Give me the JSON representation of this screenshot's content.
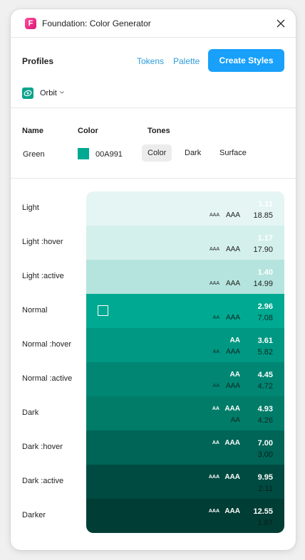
{
  "app": {
    "title": "Foundation: Color Generator",
    "logo_letter": "F"
  },
  "profiles": {
    "label": "Profiles",
    "tokens_label": "Tokens",
    "palette_label": "Palette",
    "create_label": "Create Styles",
    "current_profile": "Orbit"
  },
  "color_table": {
    "headers": {
      "name": "Name",
      "color": "Color",
      "tones": "Tones"
    },
    "row": {
      "name": "Green",
      "hex": "00A991",
      "swatch_color": "#00A991"
    },
    "tabs": [
      "Color",
      "Dark",
      "Surface"
    ],
    "active_tab": "Color"
  },
  "tones": [
    {
      "label": "Light",
      "bg": "#E4F5F3",
      "ratio_top": "1.11",
      "ratio_bottom": "18.85",
      "small_top": "",
      "badge_top": "",
      "small_bottom": "AAA",
      "badge_bottom": "AAA"
    },
    {
      "label": "Light :hover",
      "bg": "#D4F0EC",
      "ratio_top": "1.17",
      "ratio_bottom": "17.90",
      "small_top": "",
      "badge_top": "",
      "small_bottom": "AAA",
      "badge_bottom": "AAA"
    },
    {
      "label": "Light :active",
      "bg": "#B4E4DD",
      "ratio_top": "1.40",
      "ratio_bottom": "14.99",
      "small_top": "",
      "badge_top": "",
      "small_bottom": "AAA",
      "badge_bottom": "AAA"
    },
    {
      "label": "Normal",
      "bg": "#00A991",
      "ratio_top": "2.96",
      "ratio_bottom": "7.08",
      "small_top": "",
      "badge_top": "",
      "small_bottom": "AA",
      "badge_bottom": "AAA"
    },
    {
      "label": "Normal :hover",
      "bg": "#009882",
      "ratio_top": "3.61",
      "ratio_bottom": "5.82",
      "small_top": "",
      "badge_top": "AA",
      "small_bottom": "AA",
      "badge_bottom": "AAA"
    },
    {
      "label": "Normal :active",
      "bg": "#008673",
      "ratio_top": "4.45",
      "ratio_bottom": "4.72",
      "small_top": "",
      "badge_top": "AA",
      "small_bottom": "AA",
      "badge_bottom": "AAA"
    },
    {
      "label": "Dark",
      "bg": "#007C69",
      "ratio_top": "4.93",
      "ratio_bottom": "4.26",
      "small_top": "AA",
      "badge_top": "AAA",
      "small_bottom": "",
      "badge_bottom": "AA"
    },
    {
      "label": "Dark :hover",
      "bg": "#006456",
      "ratio_top": "7.00",
      "ratio_bottom": "3.00",
      "small_top": "AA",
      "badge_top": "AAA",
      "small_bottom": "",
      "badge_bottom": ""
    },
    {
      "label": "Dark :active",
      "bg": "#004B41",
      "ratio_top": "9.95",
      "ratio_bottom": "2.11",
      "small_top": "AAA",
      "badge_top": "AAA",
      "small_bottom": "",
      "badge_bottom": ""
    },
    {
      "label": "Darker",
      "bg": "#003D34",
      "ratio_top": "12.55",
      "ratio_bottom": "1.67",
      "small_top": "AAA",
      "badge_top": "AAA",
      "small_bottom": "",
      "badge_bottom": ""
    }
  ]
}
